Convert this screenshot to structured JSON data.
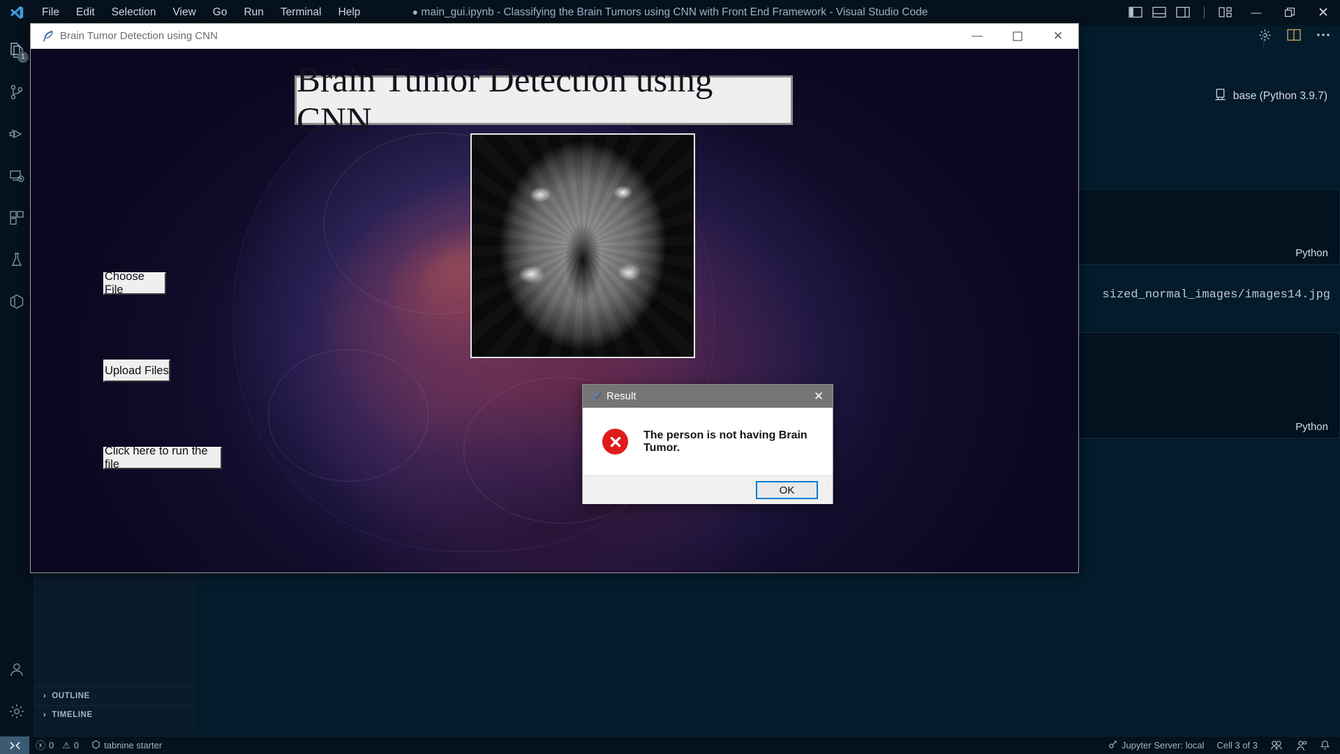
{
  "vscode": {
    "window_title": "main_gui.ipynb - Classifying the Brain Tumors using CNN with Front End Framework - Visual Studio Code",
    "title_modified_dot": "●",
    "menu": [
      {
        "label": "File",
        "name": "menu-file"
      },
      {
        "label": "Edit",
        "name": "menu-edit"
      },
      {
        "label": "Selection",
        "name": "menu-selection"
      },
      {
        "label": "View",
        "name": "menu-view"
      },
      {
        "label": "Go",
        "name": "menu-go"
      },
      {
        "label": "Run",
        "name": "menu-run"
      },
      {
        "label": "Terminal",
        "name": "menu-terminal"
      },
      {
        "label": "Help",
        "name": "menu-help"
      }
    ],
    "window_controls": {
      "minimize": "—",
      "restore": "❐",
      "close": "✕"
    },
    "layout_toggles": [
      "toggle-primary-sidebar",
      "toggle-panel",
      "toggle-secondary-sidebar",
      "customize-layout"
    ],
    "activity_bar": {
      "explorer_badge": "1",
      "items": [
        "explorer",
        "source-control",
        "run-and-debug",
        "remote-explorer",
        "extensions",
        "testing",
        "docker",
        "account",
        "manage"
      ]
    },
    "sidebar_sections": [
      {
        "label": "OUTLINE",
        "chevron": "›"
      },
      {
        "label": "TIMELINE",
        "chevron": "›"
      }
    ],
    "editor_toolbar": [
      "gear-icon",
      "split-editor-icon",
      "more-actions-icon"
    ],
    "notebook": {
      "kernel": "base (Python 3.9.7)",
      "cell_language_1": "Python",
      "cell_language_2": "Python",
      "code_fragment": "sized_normal_images/images14.jpg"
    },
    "status_bar": {
      "remote_icon": "remote-indicator",
      "errors_icon": "ⓧ",
      "errors": "0",
      "warnings_icon": "⚠",
      "warnings": "0",
      "tabnine": "tabnine starter",
      "jupyter_server": "Jupyter Server: local",
      "cell_position": "Cell 3 of 3",
      "right_icons": [
        "live-share-icon",
        "feedback-icon",
        "bell-icon"
      ]
    }
  },
  "tk_window": {
    "title": "Brain Tumor Detection using CNN",
    "icon": "feather-icon",
    "controls": {
      "minimize": "—",
      "maximize": "☐",
      "close": "✕"
    },
    "banner_text": "Brain Tumor Detection using CNN",
    "mri_image_alt": "brain-mri-scan",
    "background_alt": "brain-artwork",
    "buttons": [
      {
        "label": "Choose File",
        "name": "choose-file-button"
      },
      {
        "label": "Upload Files",
        "name": "upload-files-button"
      },
      {
        "label": "Click here to run the file",
        "name": "run-file-button"
      }
    ]
  },
  "dialog": {
    "title": "Result",
    "icon": "feather-icon",
    "close": "✕",
    "error_icon": "error-x-icon",
    "error_glyph": "✕",
    "message": "The person is not having Brain Tumor.",
    "ok_label": "OK"
  },
  "colors": {
    "vscode_chrome": "#05111c",
    "vscode_editor": "#041b2b",
    "accent_blue": "#0a7ad1",
    "error_red": "#e01b1b",
    "tk_titlebar_dialog": "#757575"
  }
}
